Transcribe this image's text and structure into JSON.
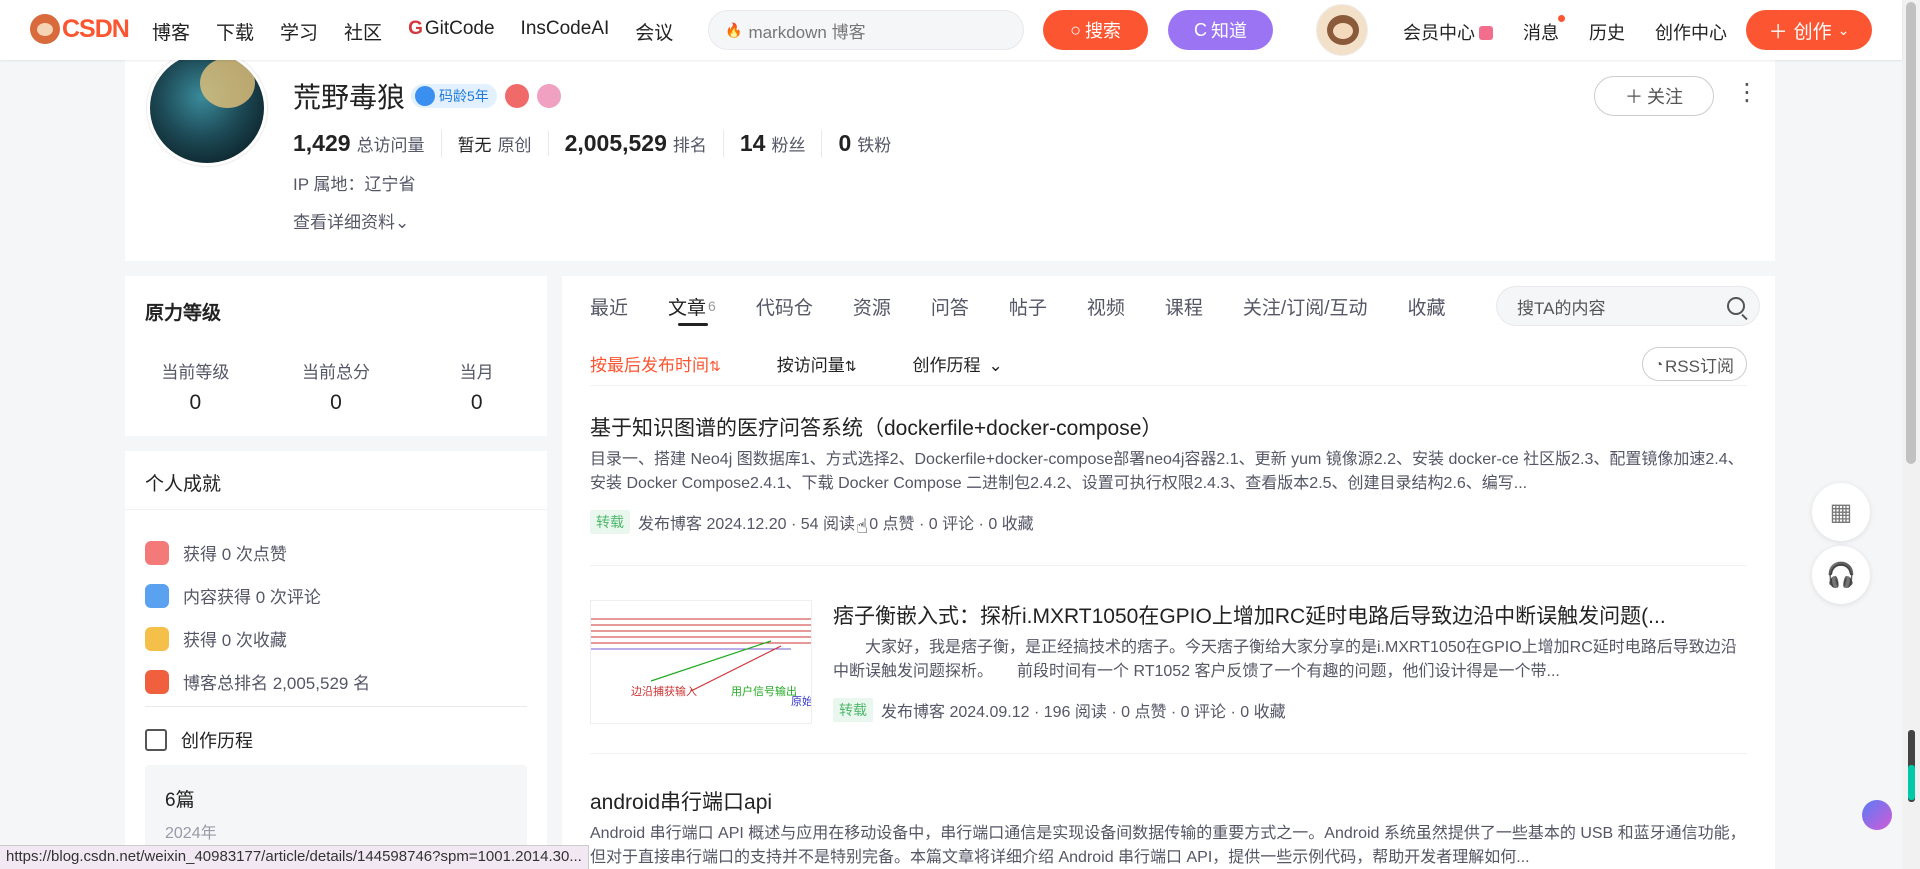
{
  "nav": {
    "logo": "CSDN",
    "links": [
      "博客",
      "下载",
      "学习",
      "社区",
      "GitCode",
      "InsCodeAI",
      "会议"
    ],
    "search_placeholder": "markdown 博客",
    "search_btn": "搜索",
    "zhidao_btn": "知道",
    "right_links": [
      "会员中心",
      "消息",
      "历史",
      "创作中心"
    ],
    "create_btn": "创作"
  },
  "profile": {
    "name": "荒野毒狼",
    "badge": "码龄5年",
    "stats": [
      {
        "num": "1,429",
        "label": "总访问量"
      },
      {
        "num": "暂无",
        "label": "原创"
      },
      {
        "num": "2,005,529",
        "label": "排名"
      },
      {
        "num": "14",
        "label": "粉丝"
      },
      {
        "num": "0",
        "label": "铁粉"
      }
    ],
    "ip": "IP 属地：辽宁省",
    "detail": "查看详细资料",
    "follow": "关注"
  },
  "level": {
    "title": "原力等级",
    "items": [
      {
        "label": "当前等级",
        "value": "0"
      },
      {
        "label": "当前总分",
        "value": "0"
      },
      {
        "label": "当月",
        "value": "0"
      }
    ]
  },
  "achievements": {
    "title": "个人成就",
    "items": [
      "获得 0 次点赞",
      "内容获得 0 次评论",
      "获得 0 次收藏",
      "博客总排名 2,005,529 名"
    ],
    "history_title": "创作历程",
    "history_count": "6篇",
    "history_year": "2024年"
  },
  "tabs": {
    "items": [
      "最近",
      "文章",
      "代码仓",
      "资源",
      "问答",
      "帖子",
      "视频",
      "课程",
      "关注/订阅/互动",
      "收藏"
    ],
    "article_count": "6",
    "search_placeholder": "搜TA的内容"
  },
  "sort": {
    "items": [
      "按最后发布时间",
      "按访问量",
      "创作历程"
    ],
    "rss": "RSS订阅"
  },
  "articles": [
    {
      "title": "基于知识图谱的医疗问答系统（dockerfile+docker-compose）",
      "desc": "目录一、搭建 Neo4j 图数据库1、方式选择2、Dockerfile+docker-compose部署neo4j容器2.1、更新 yum 镜像源2.2、安装 docker-ce 社区版2.3、配置镜像加速2.4、安装 Docker Compose2.4.1、下载 Docker Compose 二进制包2.4.2、设置可执行权限2.4.3、查看版本2.5、创建目录结构2.6、编写...",
      "tag": "转载",
      "meta": "发布博客 2024.12.20 · 54 阅读 · 0 点赞 · 0 评论 · 0 收藏"
    },
    {
      "title": "痞子衡嵌入式：探析i.MXRT1050在GPIO上增加RC延时电路后导致边沿中断误触发问题(...",
      "desc": "　　大家好，我是痞子衡，是正经搞技术的痞子。今天痞子衡给大家分享的是i.MXRT1050在GPIO上增加RC延时电路后导致边沿中断误触发问题探析。　　前段时间有一个 RT1052 客户反馈了一个有趣的问题，他们设计得是一个带...",
      "tag": "转载",
      "meta": "发布博客 2024.09.12 · 196 阅读 · 0 点赞 · 0 评论 · 0 收藏",
      "img_label1": "边沿捕获输入",
      "img_label2": "用户信号输出",
      "img_label3": "原始"
    },
    {
      "title": "android串行端口api",
      "desc": "Android 串行端口 API 概述与应用在移动设备中，串行端口通信是实现设备间数据传输的重要方式之一。Android 系统虽然提供了一些基本的 USB 和蓝牙通信功能，但对于直接串行端口的支持并不是特别完备。本篇文章将详细介绍 Android 串行端口 API，提供一些示例代码，帮助开发者理解如何..."
    }
  ],
  "status_url": "https://blog.csdn.net/weixin_40983177/article/details/144598746?spm=1001.2014.30..."
}
